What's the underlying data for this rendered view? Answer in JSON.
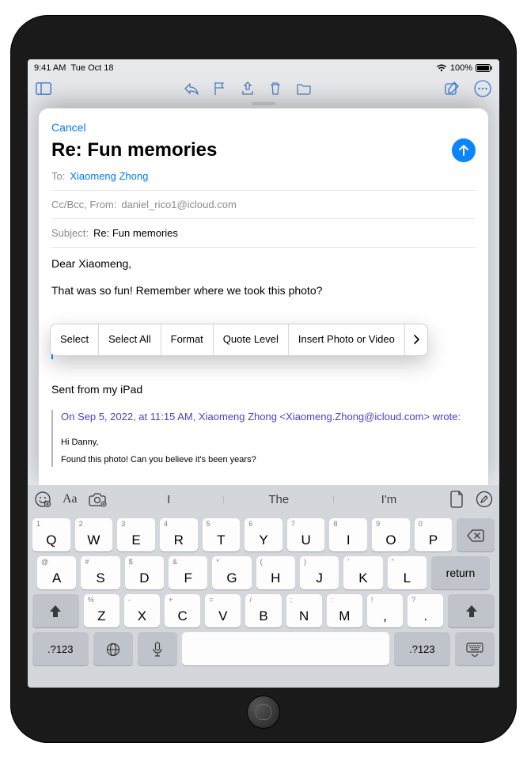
{
  "status": {
    "time": "9:41 AM",
    "date": "Tue Oct 18",
    "battery": "100%"
  },
  "toolbar_icons": {
    "sidebar": "sidebar-icon",
    "reply": "reply-icon",
    "flag": "flag-icon",
    "move": "move-icon",
    "trash": "trash-icon",
    "folder": "folder-icon",
    "compose": "compose-icon",
    "more": "ellipsis-icon"
  },
  "compose": {
    "cancel": "Cancel",
    "title": "Re: Fun memories",
    "to_label": "To:",
    "to_value": "Xiaomeng Zhong",
    "cc_label": "Cc/Bcc, From:",
    "cc_value": "daniel_rico1@icloud.com",
    "subject_label": "Subject:",
    "subject_value": "Re: Fun memories",
    "body_greeting": "Dear Xiaomeng,",
    "body_line": "That was so fun! Remember where we took this photo?",
    "signature": "Sent from my iPad",
    "quote_header": "On Sep 5, 2022, at 11:15 AM, Xiaomeng Zhong <Xiaomeng.Zhong@icloud.com> wrote:",
    "quoted_greeting": "Hi Danny,",
    "quoted_body": "Found this photo! Can you believe it's been years?"
  },
  "context_menu": {
    "select": "Select",
    "select_all": "Select All",
    "format": "Format",
    "quote_level": "Quote Level",
    "insert": "Insert Photo or Video"
  },
  "keyboard": {
    "suggestions": [
      "I",
      "The",
      "I'm"
    ],
    "row1": [
      {
        "k": "Q",
        "s": "1"
      },
      {
        "k": "W",
        "s": "2"
      },
      {
        "k": "E",
        "s": "3"
      },
      {
        "k": "R",
        "s": "4"
      },
      {
        "k": "T",
        "s": "5"
      },
      {
        "k": "Y",
        "s": "6"
      },
      {
        "k": "U",
        "s": "7"
      },
      {
        "k": "I",
        "s": "8"
      },
      {
        "k": "O",
        "s": "9"
      },
      {
        "k": "P",
        "s": "0"
      }
    ],
    "row2": [
      {
        "k": "A",
        "s": "@"
      },
      {
        "k": "S",
        "s": "#"
      },
      {
        "k": "D",
        "s": "$"
      },
      {
        "k": "F",
        "s": "&"
      },
      {
        "k": "G",
        "s": "*"
      },
      {
        "k": "H",
        "s": "("
      },
      {
        "k": "J",
        "s": ")"
      },
      {
        "k": "K",
        "s": "'"
      },
      {
        "k": "L",
        "s": "\""
      }
    ],
    "return": "return",
    "row3": [
      {
        "k": "Z",
        "s": "%"
      },
      {
        "k": "X",
        "s": "-"
      },
      {
        "k": "C",
        "s": "+"
      },
      {
        "k": "V",
        "s": "="
      },
      {
        "k": "B",
        "s": "/"
      },
      {
        "k": "N",
        "s": ";"
      },
      {
        "k": "M",
        "s": ":"
      },
      {
        "k": ",",
        "s": "!"
      },
      {
        "k": ".",
        "s": "?"
      }
    ],
    "numkey": ".?123"
  }
}
